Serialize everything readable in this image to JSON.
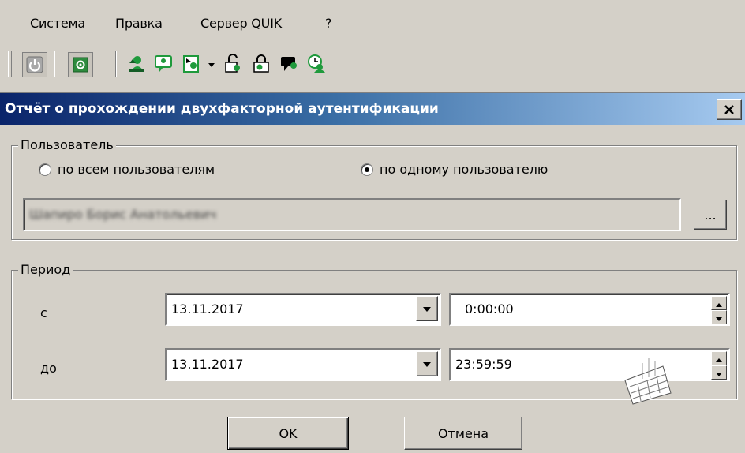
{
  "menu": {
    "items": [
      "Система",
      "Правка",
      "Сервер QUIK",
      "?"
    ]
  },
  "toolbar": {
    "icons": [
      "power-icon",
      "settings-icon",
      "user-upload-icon",
      "user-message-icon",
      "user-key-icon",
      "user-unlock-icon",
      "user-lock-icon",
      "user-chat-icon",
      "user-clock-icon"
    ]
  },
  "dialog": {
    "title": "Отчёт о прохождении двухфакторной аутентификации",
    "user_group": {
      "legend": "Пользователь",
      "radio_all": "по всем пользователям",
      "radio_one": "по одному пользователю",
      "selected": "one",
      "user_value": "Шапиро Борис Анатольевич",
      "browse_label": "..."
    },
    "period_group": {
      "legend": "Период",
      "from_label": "с",
      "to_label": "до",
      "from_date": "13.11.2017",
      "from_time": "0:00:00",
      "to_date": "13.11.2017",
      "to_time": "23:59:59"
    },
    "ok_label": "OK",
    "cancel_label": "Отмена"
  },
  "colors": {
    "title_gradient_start": "#0a246a",
    "title_gradient_end": "#a6caf0",
    "window_bg": "#d4d0c8",
    "icon_green": "#1f9a3c"
  }
}
